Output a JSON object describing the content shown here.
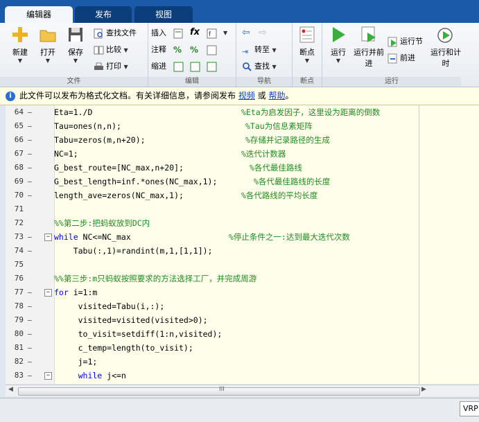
{
  "tabs": [
    "编辑器",
    "发布",
    "视图"
  ],
  "ribbon": {
    "file": {
      "label": "文件",
      "new": "新建",
      "open": "打开",
      "save": "保存",
      "find_files": "查找文件",
      "compare": "比较",
      "print": "打印"
    },
    "edit": {
      "label": "编辑",
      "insert": "插入",
      "comment": "注释",
      "indent": "缩进",
      "fx": "fx"
    },
    "nav": {
      "label": "导航",
      "goto": "转至",
      "find": "查找"
    },
    "breakpoints": {
      "label": "断点",
      "btn": "断点"
    },
    "run": {
      "label": "运行",
      "run": "运行",
      "run_advance": "运行并前进",
      "run_section": "运行节",
      "advance": "前进",
      "run_time": "运行和计时"
    }
  },
  "infobar": {
    "text": "此文件可以发布为格式化文档。有关详细信息，请参阅发布",
    "link1": "视频",
    "or": "或",
    "link2": "帮助",
    "end": "。"
  },
  "editor": {
    "lines": [
      {
        "n": "64",
        "dash": true,
        "code": "Eta=1./D",
        "comment": "%Eta为启发因子，这里设为距离的倒数",
        "ci": 270
      },
      {
        "n": "65",
        "dash": true,
        "code": "Tau=ones(n,n);",
        "comment": "%Tau为信息素矩阵",
        "ci": 276
      },
      {
        "n": "66",
        "dash": true,
        "code": "Tabu=zeros(m,n+20);",
        "comment": "%存储并记录路径的生成",
        "ci": 276
      },
      {
        "n": "67",
        "dash": true,
        "code": "NC=1;",
        "comment": "%迭代计数器",
        "ci": 270
      },
      {
        "n": "68",
        "dash": true,
        "code": "G_best_route=[NC_max,n+20];",
        "comment": "%各代最佳路线",
        "ci": 282
      },
      {
        "n": "69",
        "dash": true,
        "code": "G_best_length=inf.*ones(NC_max,1);",
        "comment": "%各代最佳路线的长度",
        "ci": 288
      },
      {
        "n": "70",
        "dash": true,
        "code": "length_ave=zeros(NC_max,1);",
        "comment": "%各代路线的平均长度",
        "ci": 270
      },
      {
        "n": "71",
        "dash": false,
        "code": "",
        "comment": ""
      },
      {
        "n": "72",
        "dash": false,
        "code": "",
        "comment": "%%第二步:把蚂蚁放到DC内",
        "ci": 0
      },
      {
        "n": "73",
        "dash": true,
        "fold": true,
        "kw": "while",
        "code": " NC<=NC_max",
        "comment": "%停止条件之一:达到最大迭代次数",
        "ci": 252
      },
      {
        "n": "74",
        "dash": true,
        "code": "    Tabu(:,1)=randint(m,1,[1,1]);",
        "comment": ""
      },
      {
        "n": "75",
        "dash": false,
        "code": "",
        "comment": ""
      },
      {
        "n": "76",
        "dash": false,
        "code": "",
        "comment": "%%第三步:m只蚂蚁按照要求的方法选择工厂，并完成周游",
        "ci": 0
      },
      {
        "n": "77",
        "dash": true,
        "fold": true,
        "kw": "for",
        "code": " i=1:m",
        "comment": ""
      },
      {
        "n": "78",
        "dash": true,
        "code": "     visited=Tabu(i,:);",
        "comment": ""
      },
      {
        "n": "79",
        "dash": true,
        "code": "     visited=visited(visited>0);",
        "comment": ""
      },
      {
        "n": "80",
        "dash": true,
        "code": "     to_visit=setdiff(1:n,visited);",
        "comment": ""
      },
      {
        "n": "81",
        "dash": true,
        "code": "     c_temp=length(to_visit);",
        "comment": ""
      },
      {
        "n": "82",
        "dash": true,
        "code": "     j=1;",
        "comment": ""
      },
      {
        "n": "83",
        "dash": true,
        "fold": true,
        "kw": "     while",
        "code": " j<=n",
        "comment": ""
      }
    ]
  },
  "scroll": {
    "thumb_grip": "III"
  },
  "status": {
    "right_field": "VRP"
  },
  "colors": {
    "keyword": "#0000ff",
    "comment": "#228b22",
    "editor_bg": "#fffeea",
    "tab_bg": "#1a5aa6"
  }
}
